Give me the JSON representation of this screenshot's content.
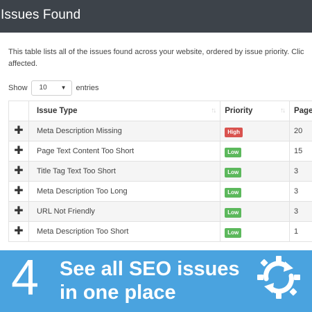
{
  "header": {
    "title": "Issues Found"
  },
  "description": {
    "line1": "This table lists all of the issues found across your website, ordered by issue priority. Clic",
    "line2": "affected."
  },
  "length_control": {
    "show_label": "Show",
    "selected": "10",
    "entries_label": "entries"
  },
  "table": {
    "columns": [
      "",
      "Issue Type",
      "Priority",
      "Pages"
    ],
    "rows": [
      {
        "issue": "Meta Description Missing",
        "priority": "High",
        "pages": "20"
      },
      {
        "issue": "Page Text Content Too Short",
        "priority": "Low",
        "pages": "15"
      },
      {
        "issue": "Title Tag Text Too Short",
        "priority": "Low",
        "pages": "3"
      },
      {
        "issue": "Meta Description Too Long",
        "priority": "Low",
        "pages": "3"
      },
      {
        "issue": "URL Not Friendly",
        "priority": "Low",
        "pages": "3"
      },
      {
        "issue": "Meta Description Too Short",
        "priority": "Low",
        "pages": "1"
      }
    ]
  },
  "banner": {
    "number": "4",
    "line1": "See all SEO issues",
    "line2": "in one place",
    "icon": "gear-sync-icon"
  },
  "colors": {
    "header_bg": "#3d434a",
    "banner_bg": "#4aa3df",
    "high": "#d9534f",
    "low": "#5cb85c"
  }
}
